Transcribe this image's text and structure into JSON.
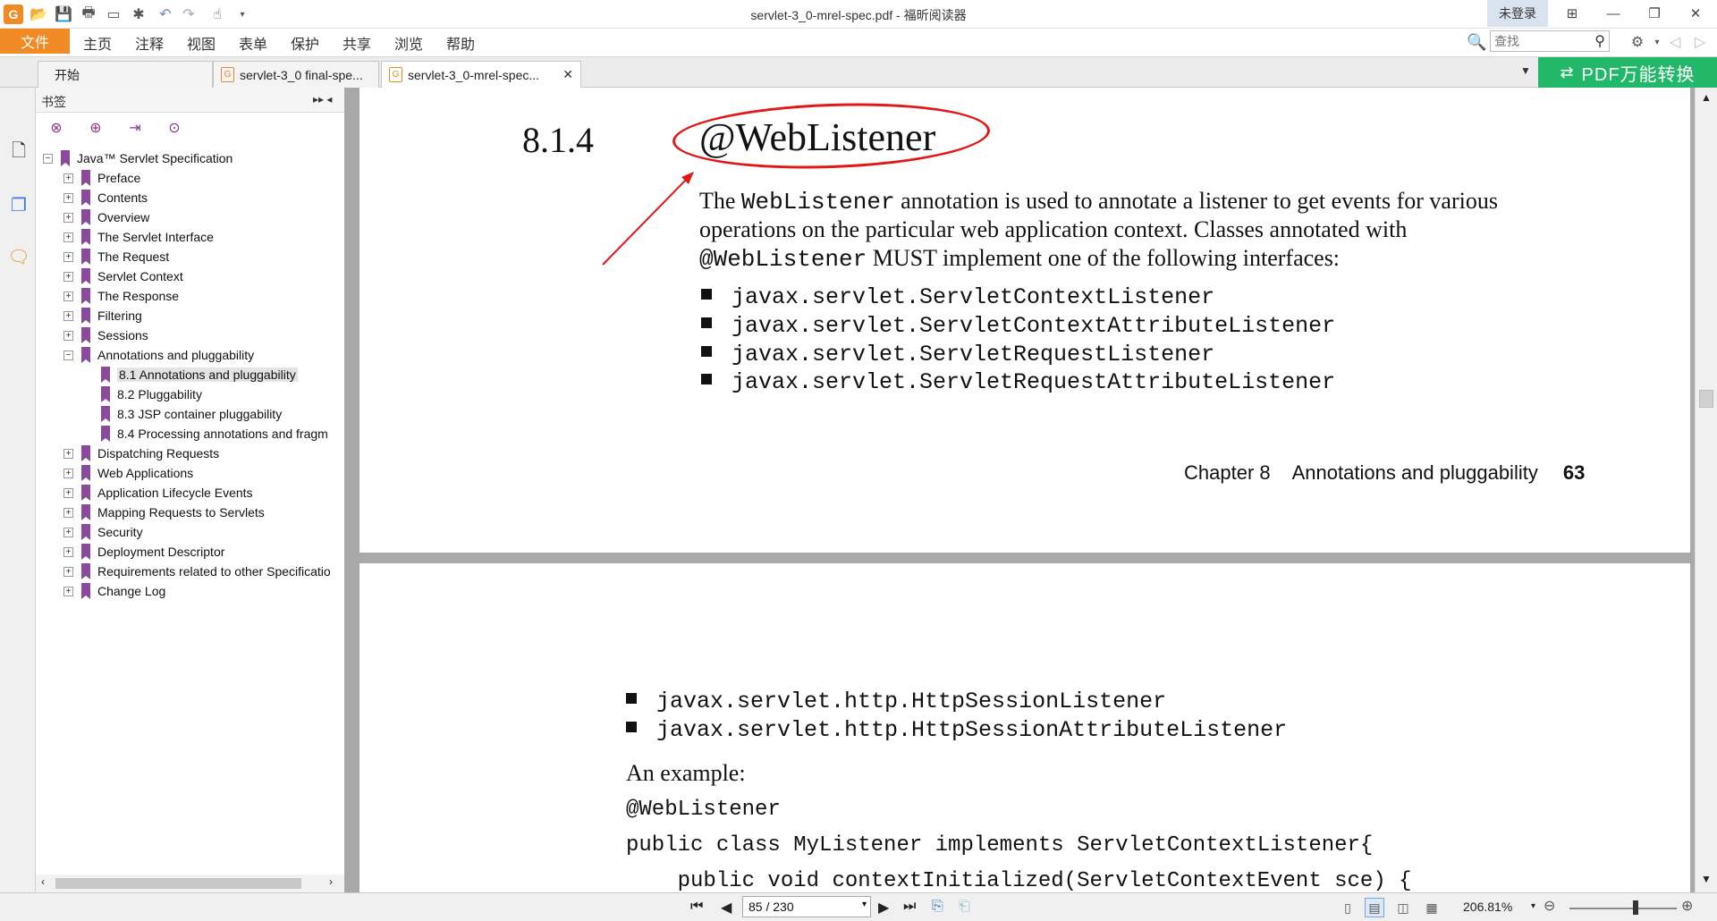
{
  "window": {
    "title": "servlet-3_0-mrel-spec.pdf - 福昕阅读器",
    "login": "未登录"
  },
  "menu": {
    "file": "文件",
    "items": [
      "主页",
      "注释",
      "视图",
      "表单",
      "保护",
      "共享",
      "浏览",
      "帮助"
    ]
  },
  "search": {
    "placeholder": "查找"
  },
  "tabs": [
    {
      "label": "开始"
    },
    {
      "label": "servlet-3_0 final-spe..."
    },
    {
      "label": "servlet-3_0-mrel-spec..."
    }
  ],
  "promo": {
    "label": "PDF万能转换"
  },
  "bookmarks": {
    "title": "书签",
    "root": "Java™ Servlet Specification",
    "items": [
      {
        "label": "Preface"
      },
      {
        "label": "Contents"
      },
      {
        "label": "Overview"
      },
      {
        "label": "The Servlet Interface"
      },
      {
        "label": "The Request"
      },
      {
        "label": "Servlet Context"
      },
      {
        "label": "The Response"
      },
      {
        "label": "Filtering"
      },
      {
        "label": "Sessions"
      },
      {
        "label": "Annotations and pluggability"
      },
      {
        "label": "8.1 Annotations and pluggability"
      },
      {
        "label": "8.2 Pluggability"
      },
      {
        "label": "8.3 JSP container pluggability"
      },
      {
        "label": "8.4 Processing annotations and fragm"
      },
      {
        "label": "Dispatching Requests"
      },
      {
        "label": "Web Applications"
      },
      {
        "label": "Application Lifecycle Events"
      },
      {
        "label": "Mapping Requests to Servlets"
      },
      {
        "label": "Security"
      },
      {
        "label": "Deployment Descriptor"
      },
      {
        "label": "Requirements related to other Specificatio"
      },
      {
        "label": "Change Log"
      }
    ]
  },
  "doc": {
    "section_number": "8.1.4",
    "section_title": "@WebListener",
    "para1_a": "The ",
    "para1_code": "WebListener",
    "para1_b": " annotation is used to annotate a listener to get events for various",
    "para2": "operations on the particular web application context. Classes annotated with",
    "para3_code": "@WebListener",
    "para3_b": " MUST implement one of the following interfaces:",
    "interfaces_page1": [
      "javax.servlet.ServletContextListener",
      "javax.servlet.ServletContextAttributeListener",
      "javax.servlet.ServletRequestListener",
      "javax.servlet.ServletRequestAttributeListener"
    ],
    "footer_chapter": "Chapter 8",
    "footer_title": "Annotations and pluggability",
    "footer_page": "63",
    "interfaces_page2": [
      "javax.servlet.http.HttpSessionListener",
      "javax.servlet.http.HttpSessionAttributeListener"
    ],
    "example_heading": "An example:",
    "code_line1": "@WebListener",
    "code_line2": "public class MyListener implements ServletContextListener{",
    "code_line3": "    public void contextInitialized(ServletContextEvent sce) {"
  },
  "status": {
    "page": "85 / 230",
    "zoom": "206.81%"
  },
  "colors": {
    "accent": "#f08a24",
    "promo": "#22b86a",
    "annotation": "#e01818",
    "bookmark": "#8b4a9c"
  }
}
